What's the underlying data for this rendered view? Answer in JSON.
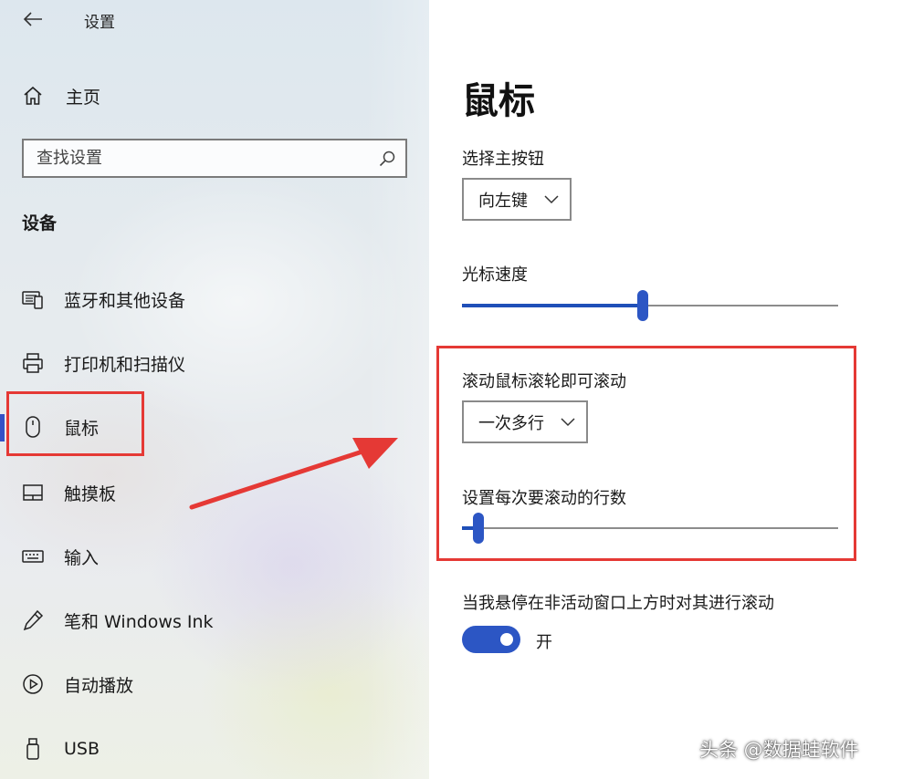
{
  "window": {
    "title": "设置"
  },
  "sidebar": {
    "home_label": "主页",
    "search_placeholder": "查找设置",
    "section_title": "设备",
    "items": [
      {
        "label": "蓝牙和其他设备",
        "icon": "bluetooth-devices-icon"
      },
      {
        "label": "打印机和扫描仪",
        "icon": "printer-icon"
      },
      {
        "label": "鼠标",
        "icon": "mouse-icon",
        "active": true
      },
      {
        "label": "触摸板",
        "icon": "touchpad-icon"
      },
      {
        "label": "输入",
        "icon": "keyboard-icon"
      },
      {
        "label": "笔和 Windows Ink",
        "icon": "pen-icon"
      },
      {
        "label": "自动播放",
        "icon": "autoplay-icon"
      },
      {
        "label": "USB",
        "icon": "usb-icon"
      }
    ]
  },
  "main": {
    "title": "鼠标",
    "primary_button": {
      "label": "选择主按钮",
      "value": "向左键"
    },
    "cursor_speed": {
      "label": "光标速度",
      "value_fraction": 0.48
    },
    "scroll_wheel": {
      "label": "滚动鼠标滚轮即可滚动",
      "value": "一次多行"
    },
    "lines_per_scroll": {
      "label": "设置每次要滚动的行数",
      "value_fraction": 0.03
    },
    "inactive_scroll": {
      "label": "当我悬停在非活动窗口上方时对其进行滚动",
      "state": "开",
      "on": true
    }
  },
  "overlay": {
    "watermark": "头条 @数据蛙软件"
  },
  "colors": {
    "accent": "#2c56c4",
    "highlight": "#e53935"
  }
}
